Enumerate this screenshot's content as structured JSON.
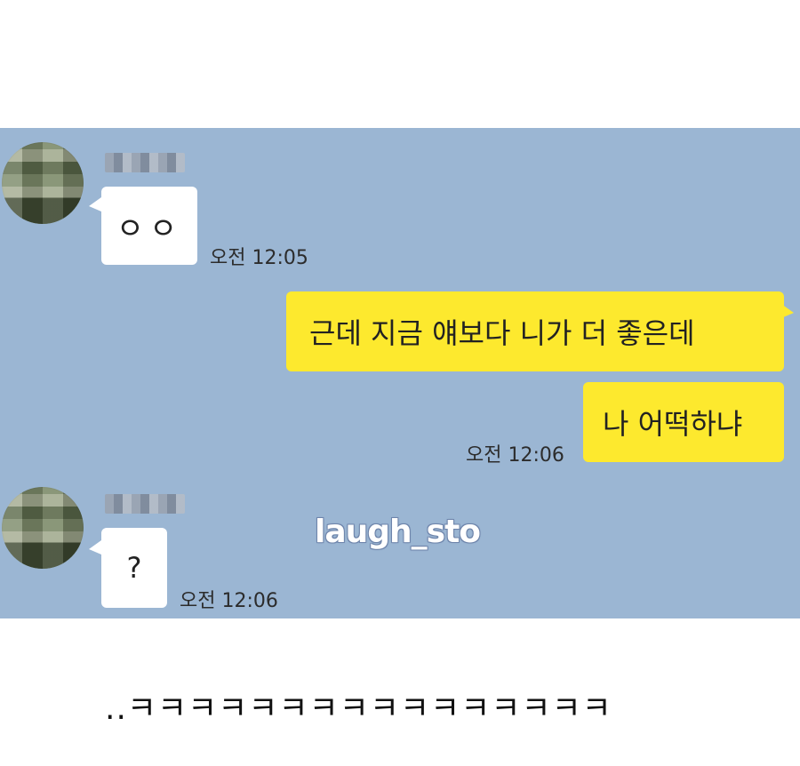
{
  "messages": [
    {
      "text": "ㅇㅇ",
      "time": "오전 12:05"
    },
    {
      "text": "근데 지금 얘보다 니가 더 좋은데"
    },
    {
      "text": "나 어떡하냐",
      "time": "오전 12:06"
    },
    {
      "text": "?",
      "time": "오전 12:06"
    }
  ],
  "watermark": "laugh_sto",
  "caption": "..ㅋㅋㅋㅋㅋㅋㅋㅋㅋㅋㅋㅋㅋㅋㅋㅋ",
  "colors": {
    "chat_background": "#9bb6d3",
    "incoming_bubble": "#ffffff",
    "outgoing_bubble": "#fde92e"
  },
  "icons": {
    "avatar": "blurred-profile-avatar"
  }
}
